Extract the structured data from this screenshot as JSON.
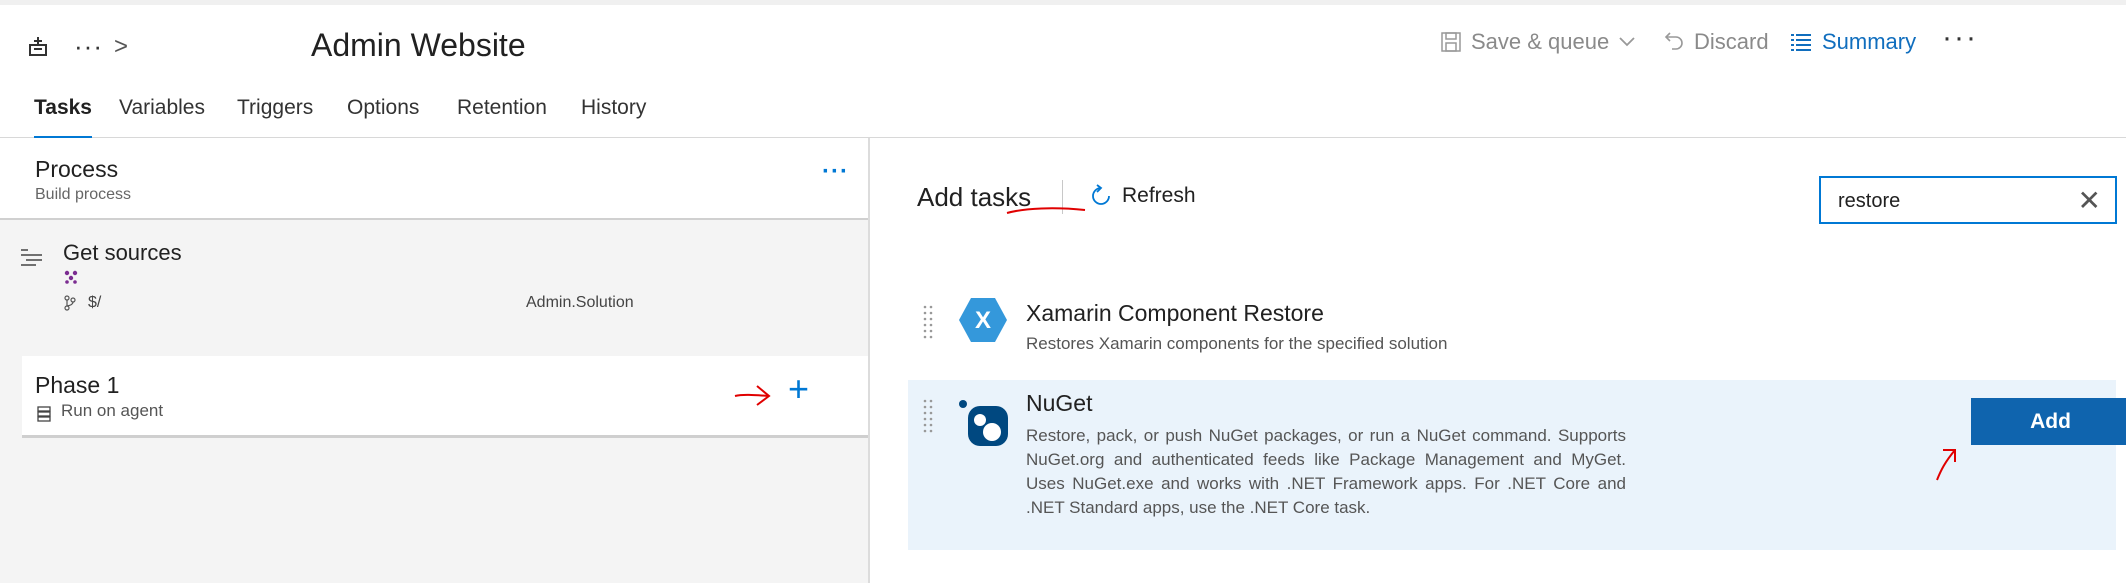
{
  "header": {
    "title": "Admin Website",
    "more_label": "···",
    "breadcrumb_chevron": ">",
    "save_queue_label": "Save & queue",
    "discard_label": "Discard",
    "summary_label": "Summary",
    "overflow_label": "···"
  },
  "tabs": [
    "Tasks",
    "Variables",
    "Triggers",
    "Options",
    "Retention",
    "History"
  ],
  "process": {
    "title": "Process",
    "subtitle": "Build process",
    "more_label": "···"
  },
  "get_sources": {
    "title": "Get sources",
    "path": "$/",
    "solution": "Admin.Solution"
  },
  "phase": {
    "title": "Phase 1",
    "subtitle": "Run on agent",
    "add_label": "+"
  },
  "add_tasks": {
    "title": "Add tasks",
    "refresh_label": "Refresh",
    "search_value": "restore",
    "clear_label": "✕",
    "add_button_label": "Add"
  },
  "tasks": [
    {
      "name": "Xamarin Component Restore",
      "description": "Restores Xamarin components for the specified solution",
      "icon": "xamarin-icon"
    },
    {
      "name": "NuGet",
      "description": "Restore, pack, or push NuGet packages, or run a NuGet command. Supports NuGet.org and authenticated feeds like Package Management and MyGet. Uses NuGet.exe and works with .NET Framework apps. For .NET Core and .NET Standard apps, use the .NET Core task.",
      "icon": "nuget-icon"
    }
  ],
  "colors": {
    "accent": "#0078d4",
    "add_button": "#0f64ae",
    "selected_row": "#eaf3fb",
    "annotation": "#e00000"
  }
}
